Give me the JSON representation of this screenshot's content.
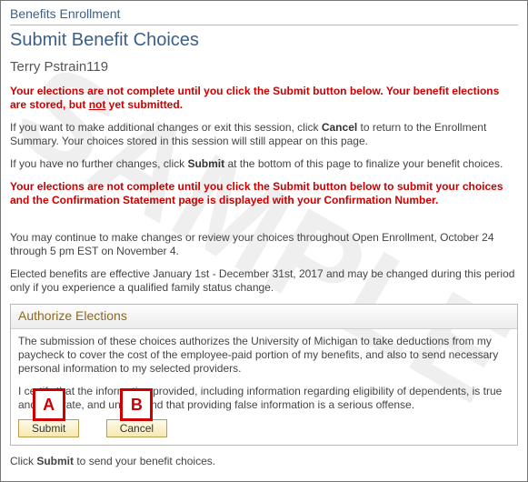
{
  "watermark": "SAMPLE",
  "section_title": "Benefits Enrollment",
  "page_title": "Submit Benefit Choices",
  "username": "Terry Pstrain119",
  "warning1_pre": "Your elections are not complete until you click the Submit button below. Your benefit elections are stored, but ",
  "warning1_underlined": "not",
  "warning1_post": " yet submitted.",
  "plain1_pre": "If you want to make additional changes or exit this session, click ",
  "plain1_bold": "Cancel",
  "plain1_post": " to return to the Enrollment Summary. Your choices stored in this session will still appear on this page.",
  "plain2_pre": "If you have no further changes, click ",
  "plain2_bold": "Submit",
  "plain2_post": " at the bottom of this page to finalize your benefit choices.",
  "warning2": "Your elections are not complete until you click the Submit button below to submit your choices and the Confirmation Statement page is displayed with your Confirmation Number.",
  "plain3": "You may continue to make changes or review your choices throughout Open Enrollment, October 24 through 5 pm EST on November 4.",
  "plain4": "Elected benefits are effective January 1st - December 31st, 2017 and may be changed during this period only if you experience a qualified family status change.",
  "auth_header": "Authorize Elections",
  "auth_body1": "The submission of these choices authorizes the University of Michigan to take deductions from my paycheck to cover the cost of the employee-paid portion of my benefits, and also to send necessary personal information to my selected providers.",
  "auth_body2": "I certify that the information provided, including information regarding eligibility of dependents, is true and accurate, and understand that providing false information is a serious offense.",
  "submit_label": "Submit",
  "cancel_label": "Cancel",
  "marker_a": "A",
  "marker_b": "B",
  "footer_pre": "Click ",
  "footer_bold": "Submit",
  "footer_post": " to send your benefit choices."
}
